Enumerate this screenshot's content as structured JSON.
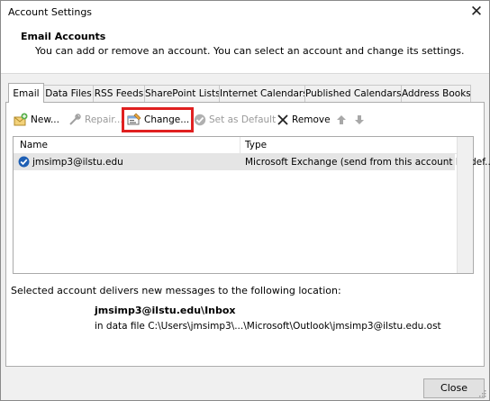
{
  "window": {
    "title": "Account Settings"
  },
  "header": {
    "title": "Email Accounts",
    "description": "You can add or remove an account. You can select an account and change its settings."
  },
  "tabs": [
    {
      "label": "Email",
      "active": true
    },
    {
      "label": "Data Files"
    },
    {
      "label": "RSS Feeds"
    },
    {
      "label": "SharePoint Lists"
    },
    {
      "label": "Internet Calendars"
    },
    {
      "label": "Published Calendars"
    },
    {
      "label": "Address Books"
    }
  ],
  "toolbar": {
    "new_label": "New...",
    "repair_label": "Repair...",
    "change_label": "Change...",
    "set_default_label": "Set as Default",
    "remove_label": "Remove"
  },
  "accounts_table": {
    "headers": [
      "Name",
      "Type"
    ],
    "rows": [
      {
        "name": "jmsimp3@ilstu.edu",
        "type": "Microsoft Exchange (send from this account by def..."
      }
    ]
  },
  "delivery": {
    "label": "Selected account delivers new messages to the following location:",
    "path": "jmsimp3@ilstu.edu\\Inbox",
    "file": "in data file C:\\Users\\jmsimp3\\...\\Microsoft\\Outlook\\jmsimp3@ilstu.edu.ost"
  },
  "footer": {
    "close_label": "Close"
  },
  "colors": {
    "highlight": "#e02020",
    "check_blue": "#1e5fb4"
  }
}
